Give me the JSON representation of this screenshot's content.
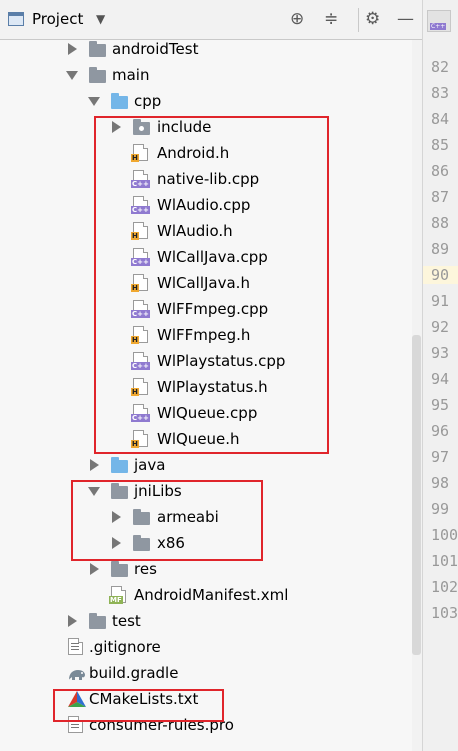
{
  "toolbar": {
    "title": "Project",
    "icons": [
      "crosshair-icon",
      "collapse-icon",
      "gear-icon",
      "minimize-icon"
    ]
  },
  "tree": [
    {
      "label": "androidTest",
      "type": "folder",
      "level": 1,
      "expanded": false
    },
    {
      "label": "main",
      "type": "folder",
      "level": 1,
      "expanded": true
    },
    {
      "label": "cpp",
      "type": "folder-blue",
      "level": 2,
      "expanded": true
    },
    {
      "label": "include",
      "type": "folder-include",
      "level": 3,
      "expanded": false
    },
    {
      "label": "Android.h",
      "type": "h",
      "level": 3
    },
    {
      "label": "native-lib.cpp",
      "type": "cpp",
      "level": 3
    },
    {
      "label": "WlAudio.cpp",
      "type": "cpp",
      "level": 3
    },
    {
      "label": "WlAudio.h",
      "type": "h",
      "level": 3
    },
    {
      "label": "WlCallJava.cpp",
      "type": "cpp",
      "level": 3
    },
    {
      "label": "WlCallJava.h",
      "type": "h",
      "level": 3
    },
    {
      "label": "WlFFmpeg.cpp",
      "type": "cpp",
      "level": 3
    },
    {
      "label": "WlFFmpeg.h",
      "type": "h",
      "level": 3
    },
    {
      "label": "WlPlaystatus.cpp",
      "type": "cpp",
      "level": 3
    },
    {
      "label": "WlPlaystatus.h",
      "type": "h",
      "level": 3
    },
    {
      "label": "WlQueue.cpp",
      "type": "cpp",
      "level": 3
    },
    {
      "label": "WlQueue.h",
      "type": "h",
      "level": 3
    },
    {
      "label": "java",
      "type": "folder-blue",
      "level": 2,
      "expanded": false
    },
    {
      "label": "jniLibs",
      "type": "folder",
      "level": 2,
      "expanded": true
    },
    {
      "label": "armeabi",
      "type": "folder",
      "level": 3,
      "expanded": false
    },
    {
      "label": "x86",
      "type": "folder",
      "level": 3,
      "expanded": false
    },
    {
      "label": "res",
      "type": "folder-res",
      "level": 2,
      "expanded": false
    },
    {
      "label": "AndroidManifest.xml",
      "type": "manifest",
      "level": 2
    },
    {
      "label": "test",
      "type": "folder",
      "level": 1,
      "expanded": false
    },
    {
      "label": ".gitignore",
      "type": "txt",
      "level": 0
    },
    {
      "label": "build.gradle",
      "type": "gradle",
      "level": 0
    },
    {
      "label": "CMakeLists.txt",
      "type": "cmake",
      "level": 0
    },
    {
      "label": "consumer-rules.pro",
      "type": "txt",
      "level": 0
    }
  ],
  "gutter": {
    "line_numbers": [
      "82",
      "83",
      "84",
      "85",
      "86",
      "87",
      "88",
      "89",
      "90",
      "91",
      "92",
      "93",
      "94",
      "95",
      "96",
      "97",
      "98",
      "99",
      "100",
      "101",
      "102",
      "103"
    ],
    "highlighted": "90"
  },
  "colors": {
    "highlight_box": "#e0252b",
    "folder": "#8f97a1",
    "folder_source": "#74b6e8",
    "badge_h": "#f0a830",
    "badge_cpp": "#8f7ad0"
  }
}
